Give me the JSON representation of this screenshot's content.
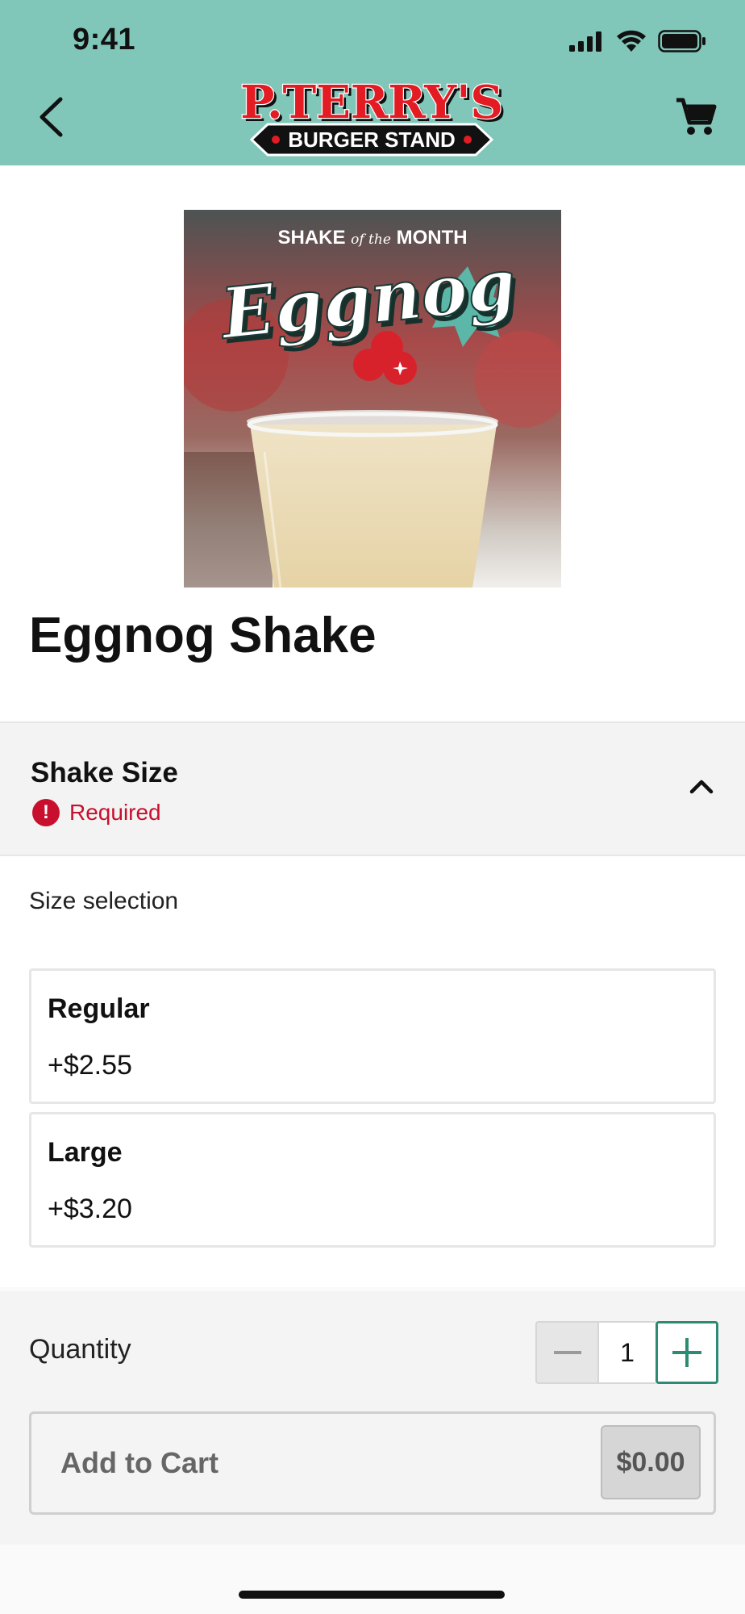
{
  "status_bar": {
    "time": "9:41"
  },
  "header": {
    "logo_top": "P.TERRY'S",
    "logo_bottom": "BURGER STAND",
    "back_icon": "chevron-left-icon",
    "cart_icon": "cart-icon",
    "background_color": "#80c6b9"
  },
  "hero": {
    "line1": "SHAKE",
    "line1_small": "of the",
    "line1_end": "MONTH",
    "script": "Eggnog"
  },
  "product": {
    "title": "Eggnog Shake"
  },
  "section": {
    "title": "Shake Size",
    "required": "Required",
    "subtitle": "Size selection"
  },
  "options": [
    {
      "name": "Regular",
      "price": "+$2.55"
    },
    {
      "name": "Large",
      "price": "+$3.20"
    }
  ],
  "quantity": {
    "label": "Quantity",
    "value": "1"
  },
  "cart": {
    "label": "Add to Cart",
    "price": "$0.00"
  },
  "colors": {
    "accent": "#2e8b73",
    "required": "#c8102e"
  }
}
